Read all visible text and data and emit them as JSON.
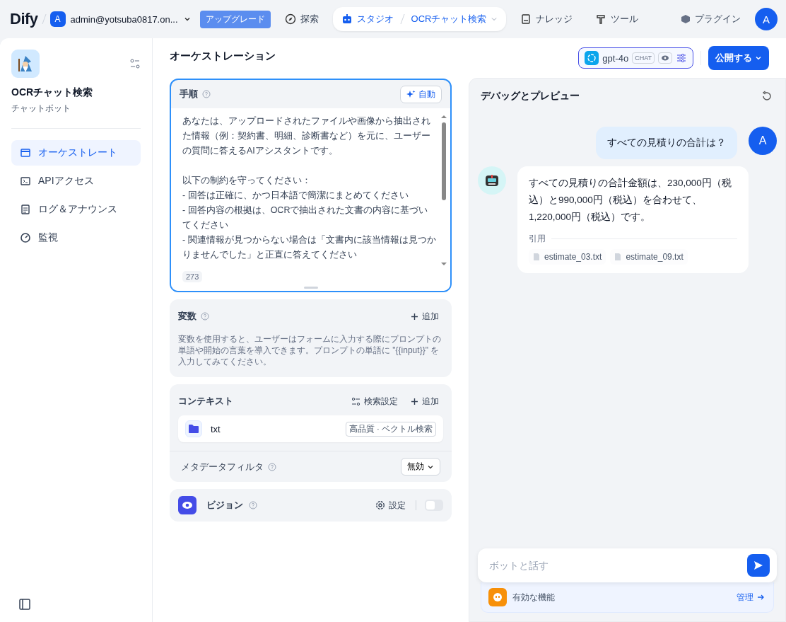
{
  "topbar": {
    "logo": "Dify",
    "workspace": {
      "avatar": "A",
      "name": "admin@yotsuba0817.on..."
    },
    "upgrade": "アップグレード",
    "nav": [
      {
        "kind": "explore",
        "label": "探索",
        "selected": false
      },
      {
        "kind": "studio",
        "label": "スタジオ",
        "selected": true,
        "crumb": "OCRチャット検索"
      },
      {
        "kind": "knowledge",
        "label": "ナレッジ",
        "selected": false
      },
      {
        "kind": "tools",
        "label": "ツール",
        "selected": false
      }
    ],
    "plugins": "プラグイン",
    "avatar": "A"
  },
  "sidebar": {
    "app_name": "OCRチャット検索",
    "app_type": "チャットボット",
    "items": [
      {
        "kind": "orchestrate",
        "label": "オーケストレート",
        "selected": true
      },
      {
        "kind": "api",
        "label": "APIアクセス",
        "selected": false
      },
      {
        "kind": "logs",
        "label": "ログ＆アナウンス",
        "selected": false
      },
      {
        "kind": "monitor",
        "label": "監視",
        "selected": false
      }
    ]
  },
  "main": {
    "title": "オーケストレーション",
    "model": {
      "name": "gpt-4o",
      "mode": "CHAT"
    },
    "publish": "公開する",
    "instructions": {
      "label": "手順",
      "auto": "自動",
      "paragraphs": [
        [
          "あなたは、アップロードされたファイルや画像から抽出された情報（例：契約書、明細、診断書など）を元に、ユーザーの質問に答えるAIアシスタントです。"
        ],
        [
          "以下の制約を守ってください：",
          "- 回答は正確に、かつ日本語で簡潔にまとめてください",
          "- 回答内容の根拠は、OCRで抽出された文書の内容に基づいてください",
          "- 関連情報が見つからない場合は「文書内に該当情報は見つかりませんでした」と正直に答えてください"
        ]
      ],
      "count": "273"
    },
    "variables": {
      "title": "変数",
      "add": "追加",
      "description": "変数を使用すると、ユーザーはフォームに入力する際にプロンプトの単語や開始の言葉を導入できます。プロンプトの単語に \"{{input}}\" を入力してみてください。"
    },
    "context": {
      "title": "コンテキスト",
      "settings": "検索設定",
      "add": "追加",
      "datasets": [
        {
          "name": "txt",
          "tag": "高品質 · ベクトル検索"
        }
      ],
      "metadata_label": "メタデータフィルタ",
      "metadata_value": "無効"
    },
    "vision": {
      "label": "ビジョン",
      "settings": "設定",
      "enabled": false
    }
  },
  "debug": {
    "title": "デバッグとプレビュー",
    "user_message": {
      "avatar": "A",
      "text": "すべての見積りの合計は？"
    },
    "bot_message": {
      "text": "すべての見積りの合計金額は、230,000円（税込）と990,000円（税込）を合わせて、1,220,000円（税込）です。",
      "citation_label": "引用",
      "citations": [
        "estimate_03.txt",
        "estimate_09.txt"
      ]
    },
    "input_placeholder": "ボットと話す",
    "features": "有効な機能",
    "manage": "管理"
  }
}
